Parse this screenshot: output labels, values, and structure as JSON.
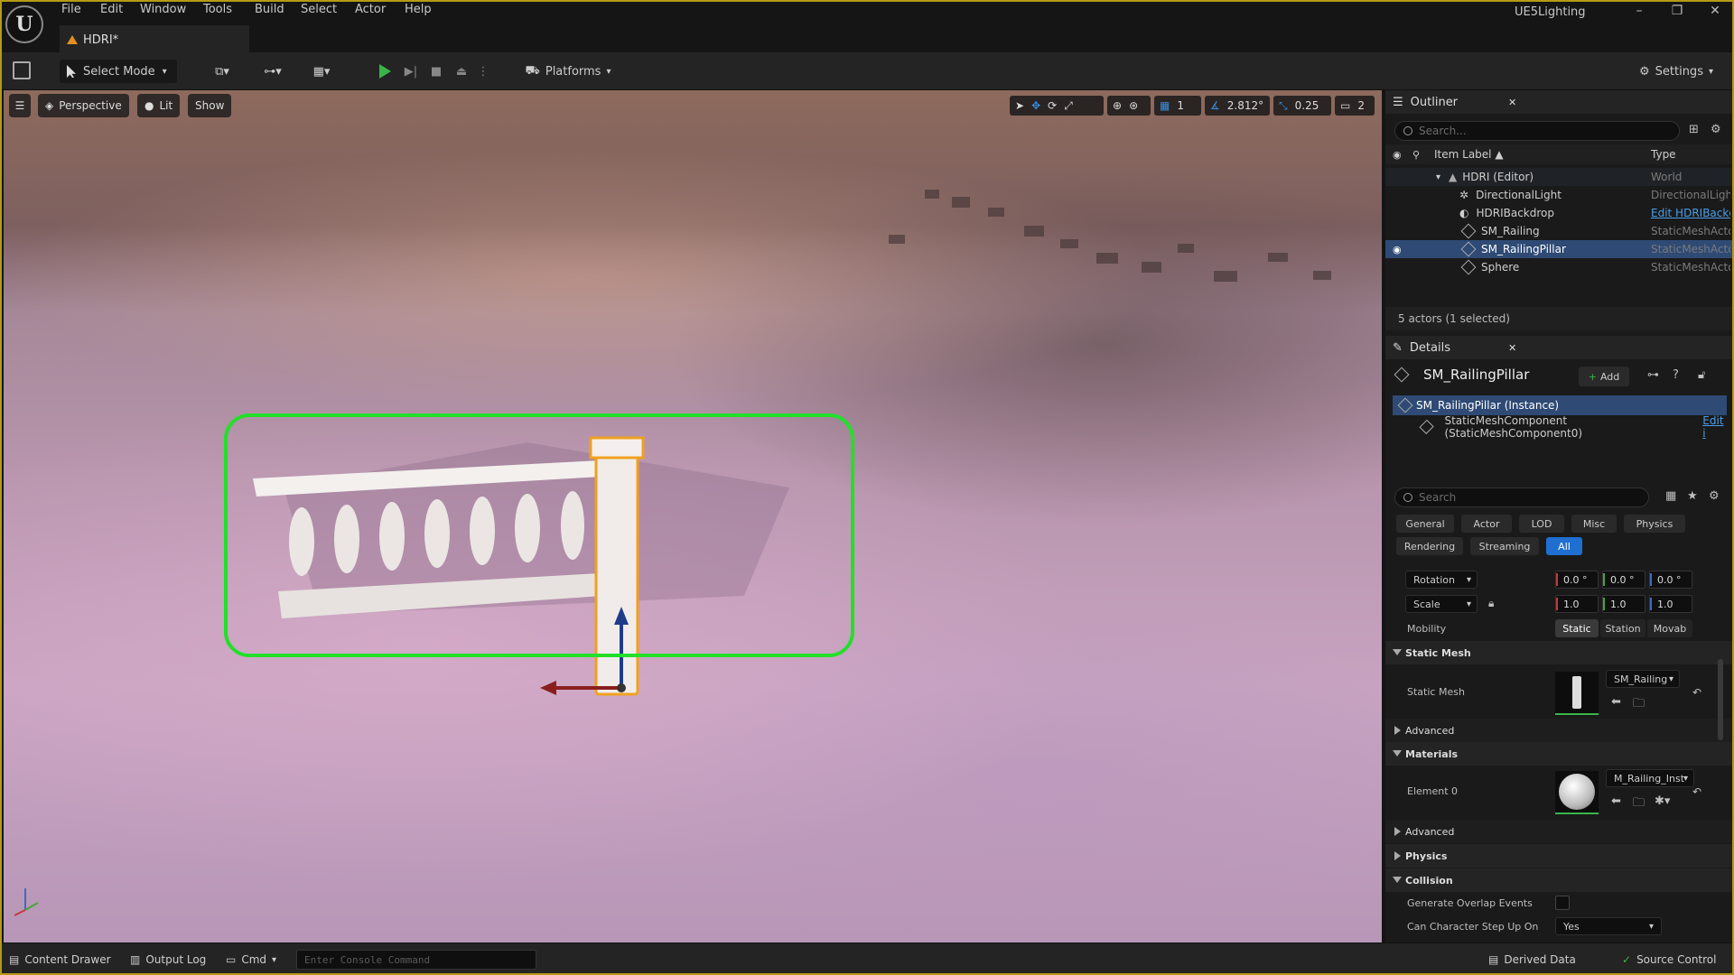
{
  "menu": [
    "File",
    "Edit",
    "Window",
    "Tools",
    "Build",
    "Select",
    "Actor",
    "Help"
  ],
  "project_name": "UE5Lighting",
  "logo_text": "U",
  "tab": {
    "label": "HDRI*"
  },
  "toolbar": {
    "select_mode": "Select Mode",
    "platforms": "Platforms",
    "settings": "Settings"
  },
  "viewport": {
    "perspective": "Perspective",
    "lit": "Lit",
    "show": "Show",
    "grid_snap": "1",
    "rotation_snap": "2.812°",
    "scale_snap": "0.25",
    "camera_speed": "2"
  },
  "outliner": {
    "title": "Outliner",
    "search_placeholder": "Search...",
    "col_label": "Item Label ▲",
    "col_type": "Type",
    "rows": [
      {
        "label": "HDRI (Editor)",
        "type": "World"
      },
      {
        "label": "DirectionalLight",
        "type": "DirectionalLigh"
      },
      {
        "label": "HDRIBackdrop",
        "type": "Edit HDRIBackd"
      },
      {
        "label": "SM_Railing",
        "type": "StaticMeshActo"
      },
      {
        "label": "SM_RailingPillar",
        "type": "StaticMeshActo"
      },
      {
        "label": "Sphere",
        "type": "StaticMeshActo"
      }
    ],
    "status": "5 actors (1 selected)"
  },
  "details": {
    "title": "Details",
    "actor_name": "SM_RailingPillar",
    "add_label": "Add",
    "instance": "SM_RailingPillar (Instance)",
    "component": "StaticMeshComponent (StaticMeshComponent0)",
    "component_edit": "Edit i",
    "search_placeholder": "Search",
    "filters": [
      "General",
      "Actor",
      "LOD",
      "Misc",
      "Physics",
      "Rendering",
      "Streaming",
      "All"
    ],
    "rotation_label": "Rotation",
    "rotation": [
      "0.0 °",
      "0.0 °",
      "0.0 °"
    ],
    "scale_label": "Scale",
    "scale": [
      "1.0",
      "1.0",
      "1.0"
    ],
    "mobility_label": "Mobility",
    "mobility": [
      "Static",
      "Station",
      "Movab"
    ],
    "static_mesh_cat": "Static Mesh",
    "static_mesh_label": "Static Mesh",
    "static_mesh_value": "SM_Railing",
    "advanced": "Advanced",
    "materials_cat": "Materials",
    "element0_label": "Element 0",
    "element0_value": "M_Railing_Inst",
    "physics_cat": "Physics",
    "collision_cat": "Collision",
    "overlap_label": "Generate Overlap Events",
    "step_label": "Can Character Step Up On",
    "step_value": "Yes"
  },
  "statusbar": {
    "content_drawer": "Content Drawer",
    "output_log": "Output Log",
    "cmd": "Cmd",
    "console_placeholder": "Enter Console Command",
    "derived_data": "Derived Data",
    "source_control": "Source Control"
  }
}
